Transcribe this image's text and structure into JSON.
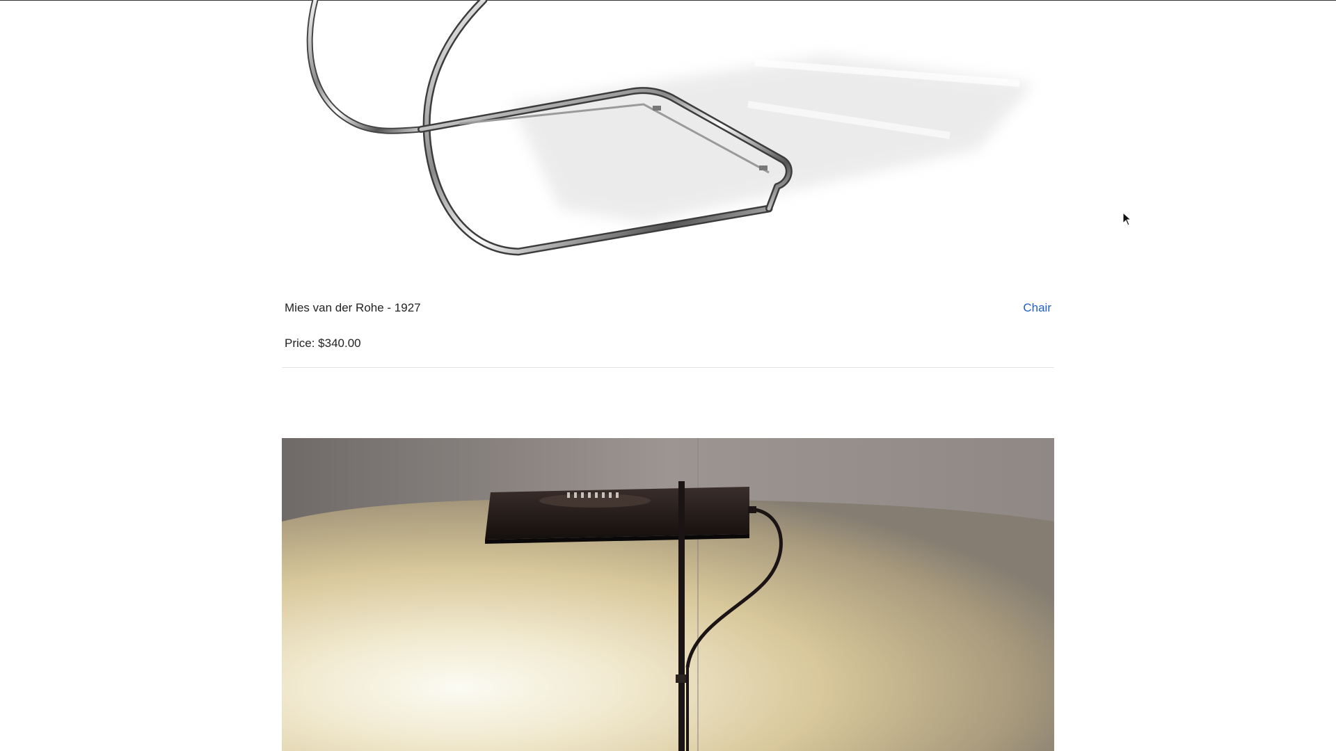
{
  "products": [
    {
      "image_subject": "chrome tubular cantilever chair",
      "designer_line": "Mies van der Rohe - 1927",
      "category": "Chair",
      "price_label": "Price: $340.00"
    },
    {
      "image_subject": "black floor lamp with flat rectangular head"
    }
  ],
  "colors": {
    "link": "#1f5fbf",
    "text": "#222222",
    "divider": "#e2e2e2"
  },
  "icons": [
    "mouse-pointer-icon"
  ]
}
